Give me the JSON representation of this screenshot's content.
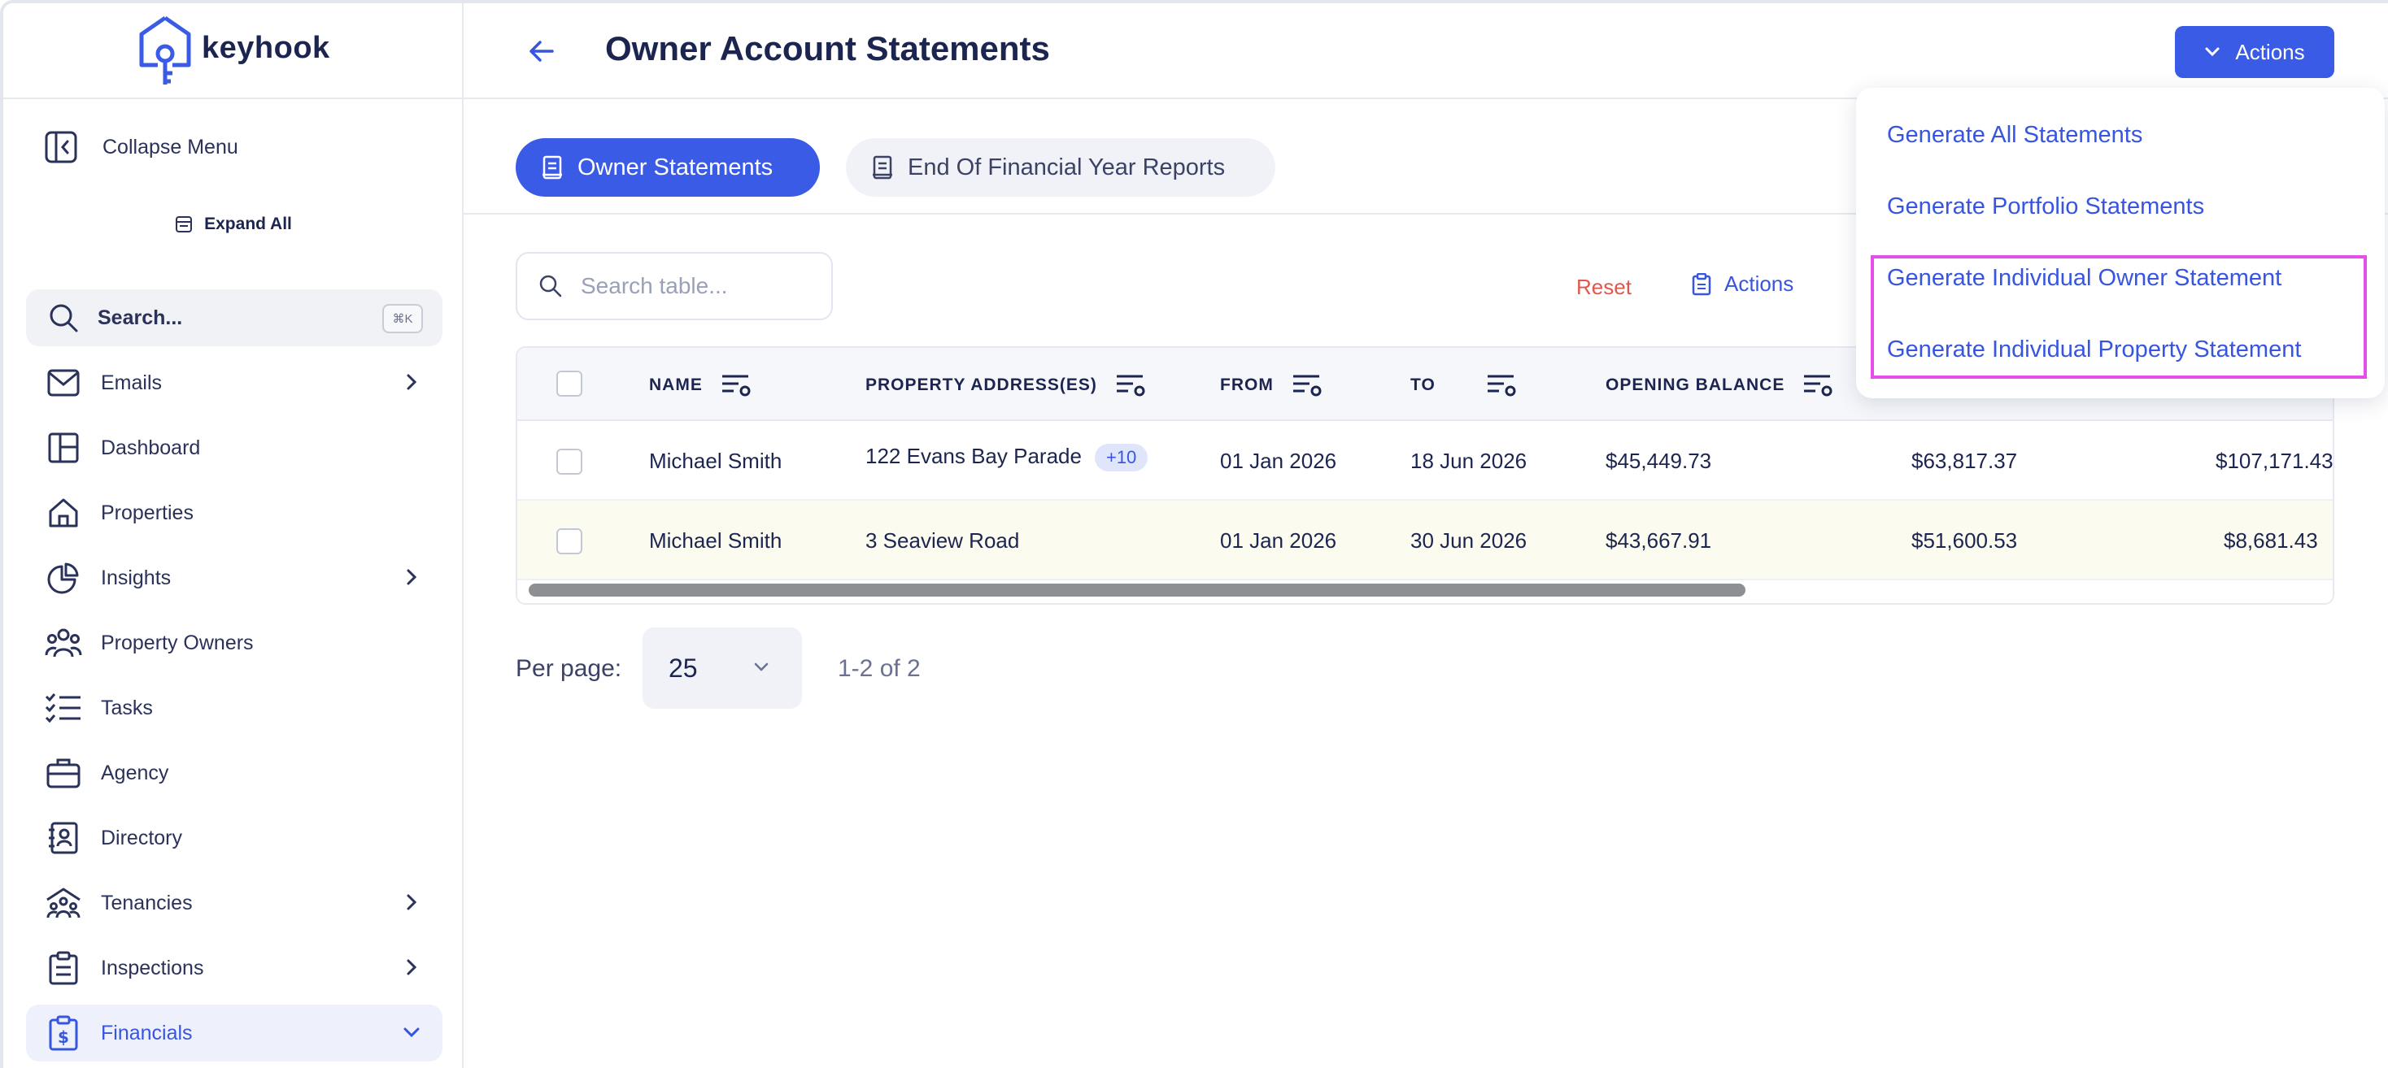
{
  "brand": {
    "name": "keyhook",
    "color": "#3a5be6"
  },
  "sidebar": {
    "collapse_label": "Collapse Menu",
    "expand_all_label": "Expand All",
    "search_label": "Search...",
    "search_shortcut": "⌘K",
    "items": [
      {
        "label": "Emails",
        "icon": "mail-icon",
        "has_chevron": true
      },
      {
        "label": "Dashboard",
        "icon": "layout-icon",
        "has_chevron": false
      },
      {
        "label": "Properties",
        "icon": "home-icon",
        "has_chevron": false
      },
      {
        "label": "Insights",
        "icon": "pie-chart-icon",
        "has_chevron": true
      },
      {
        "label": "Property Owners",
        "icon": "users-icon",
        "has_chevron": false
      },
      {
        "label": "Tasks",
        "icon": "checklist-icon",
        "has_chevron": false
      },
      {
        "label": "Agency",
        "icon": "briefcase-icon",
        "has_chevron": false
      },
      {
        "label": "Directory",
        "icon": "contact-book-icon",
        "has_chevron": false
      },
      {
        "label": "Tenancies",
        "icon": "tenancy-icon",
        "has_chevron": true
      },
      {
        "label": "Inspections",
        "icon": "clipboard-icon",
        "has_chevron": true
      },
      {
        "label": "Financials",
        "icon": "financials-icon",
        "has_chevron": true,
        "active": true
      }
    ]
  },
  "header": {
    "title": "Owner Account Statements",
    "actions_label": "Actions"
  },
  "tabs": [
    {
      "label": "Owner Statements",
      "active": true
    },
    {
      "label": "End Of Financial Year Reports",
      "active": false
    }
  ],
  "toolbar": {
    "search_placeholder": "Search table...",
    "reset_label": "Reset",
    "actions_label": "Actions"
  },
  "table": {
    "columns": [
      "NAME",
      "PROPERTY ADDRESS(ES)",
      "FROM",
      "TO",
      "OPENING BALANCE"
    ],
    "rows": [
      {
        "name": "Michael Smith",
        "address": "122 Evans Bay Parade",
        "extra": "+10",
        "from": "01 Jan 2026",
        "to": "18 Jun 2026",
        "opening": "$45,449.73",
        "col6": "$63,817.37",
        "col7": "$107,171.43"
      },
      {
        "name": "Michael Smith",
        "address": "3 Seaview Road",
        "extra": "",
        "from": "01 Jan 2026",
        "to": "30 Jun 2026",
        "opening": "$43,667.91",
        "col6": "$51,600.53",
        "col7": "$8,681.43"
      }
    ]
  },
  "pagination": {
    "per_page_label": "Per page:",
    "per_page_value": "25",
    "range": "1-2 of 2"
  },
  "actions_menu": {
    "items": [
      "Generate All Statements",
      "Generate Portfolio Statements",
      "Generate Individual Owner Statement",
      "Generate Individual Property Statement"
    ],
    "highlight_color": "#e54ee8"
  }
}
